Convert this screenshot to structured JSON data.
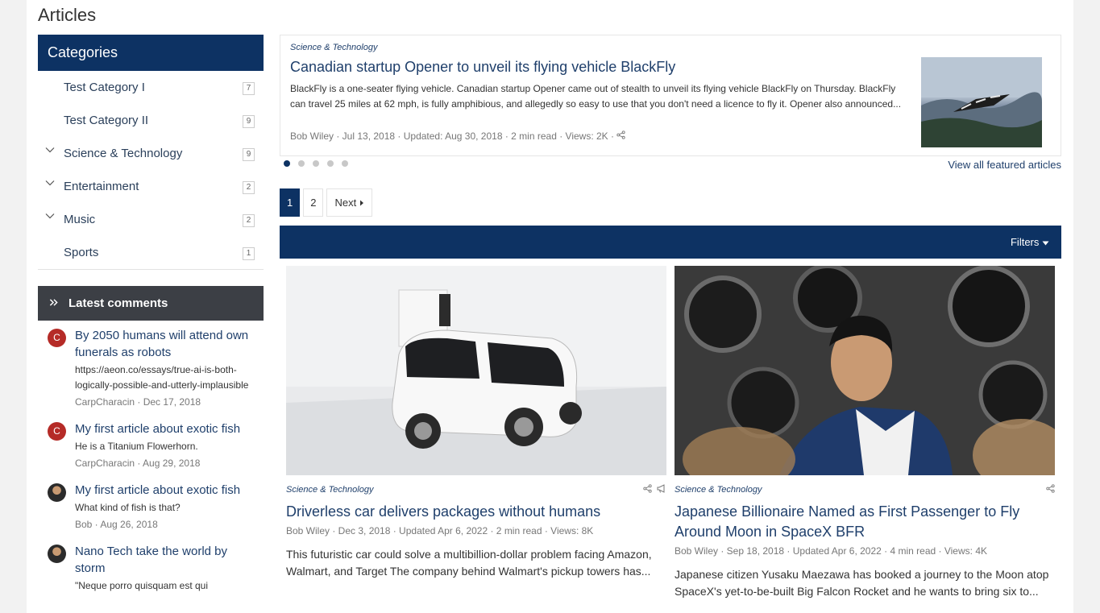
{
  "page": {
    "title": "Articles"
  },
  "sidebar": {
    "categories_title": "Categories",
    "categories": [
      {
        "label": "Test Category I",
        "count": "7",
        "expandable": false
      },
      {
        "label": "Test Category II",
        "count": "9",
        "expandable": false
      },
      {
        "label": "Science & Technology",
        "count": "9",
        "expandable": true
      },
      {
        "label": "Entertainment",
        "count": "2",
        "expandable": true
      },
      {
        "label": "Music",
        "count": "2",
        "expandable": true
      },
      {
        "label": "Sports",
        "count": "1",
        "expandable": false
      }
    ],
    "latest_comments_title": "Latest comments",
    "comments": [
      {
        "avatar": "C",
        "title": "By 2050 humans will attend own funerals as robots",
        "body": "https://aeon.co/essays/true-ai-is-both-logically-possible-and-utterly-implausible",
        "meta": "CarpCharacin · Dec 17, 2018"
      },
      {
        "avatar": "C",
        "title": "My first article about exotic fish",
        "body": "He is a Titanium Flowerhorn.",
        "meta": "CarpCharacin · Aug 29, 2018"
      },
      {
        "avatar": "",
        "title": "My first article about exotic fish",
        "body": "What kind of fish is that?",
        "meta": "Bob · Aug 26, 2018"
      },
      {
        "avatar": "",
        "title": "Nano Tech take the world by storm",
        "body": "\"Neque porro quisquam est qui",
        "meta": ""
      }
    ]
  },
  "featured": {
    "category": "Science & Technology",
    "title": "Canadian startup Opener to unveil its flying vehicle BlackFly",
    "description": "BlackFly is a one-seater flying vehicle. Canadian startup Opener came out of stealth to unveil its flying vehicle BlackFly on Thursday. BlackFly can travel 25 miles at 62 mph, is fully amphibious, and allegedly so easy to use that you don't need a licence to fly it. Opener also announced...",
    "meta": "Bob Wiley · Jul 13, 2018 · Updated: Aug 30, 2018 · 2 min read · Views: 2K ·",
    "view_all": "View all featured articles"
  },
  "pagination": {
    "pages": [
      "1",
      "2"
    ],
    "active": "1",
    "next": "Next"
  },
  "filters_label": "Filters",
  "articles": [
    {
      "category": "Science & Technology",
      "title": "Driverless car delivers packages without humans",
      "meta": "Bob Wiley · Dec 3, 2018 · Updated Apr 6, 2022 · 2 min read · Views: 8K",
      "description": "This futuristic car could solve a multibillion-dollar problem facing Amazon, Walmart, and Target The company behind Walmart's pickup towers has...",
      "icons": [
        "share-icon",
        "megaphone-icon"
      ]
    },
    {
      "category": "Science & Technology",
      "title": "Japanese Billionaire Named as First Passenger to Fly Around Moon in SpaceX BFR",
      "meta": "Bob Wiley · Sep 18, 2018 · Updated Apr 6, 2022 · 4 min read · Views: 4K",
      "description": "Japanese citizen Yusaku Maezawa has booked a journey to the Moon atop SpaceX's yet-to-be-built Big Falcon Rocket and he wants to bring six to...",
      "icons": [
        "share-icon"
      ]
    }
  ],
  "colors": {
    "brand": "#0d3263",
    "comments_header": "#3c3f45",
    "avatar_red": "#b52b27"
  }
}
